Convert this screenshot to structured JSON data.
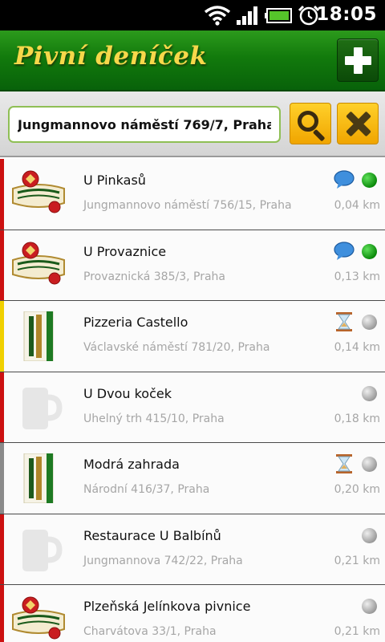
{
  "status_bar": {
    "time": "18:05",
    "icons": [
      "wifi-icon",
      "signal-icon",
      "battery-icon",
      "alarm-icon"
    ]
  },
  "app": {
    "title": "Pivní deníček",
    "add_button_icon": "plus-icon"
  },
  "search": {
    "value": "Jungmannovo náměstí 769/7, Praha",
    "search_icon": "search-icon",
    "clear_icon": "clear-icon"
  },
  "colors": {
    "header_green": "#127a0c",
    "title_yellow": "#f6d84a",
    "button_orange": "#f0a500",
    "stripe_red": "#cc1111",
    "stripe_yellow": "#f0d000",
    "stripe_grey": "#8a8a8a"
  },
  "pubs": [
    {
      "name": "U Pinkasů",
      "address": "Jungmannovo náměstí 756/15, Praha",
      "distance": "0,04 km",
      "logo": "pilsner-urquell-logo",
      "stripe": "red",
      "extra_icon": "comment-icon",
      "status": "green"
    },
    {
      "name": "U Provaznice",
      "address": "Provaznická 385/3, Praha",
      "distance": "0,13 km",
      "logo": "pilsner-urquell-logo",
      "stripe": "red",
      "extra_icon": "comment-icon",
      "status": "green"
    },
    {
      "name": "Pizzeria Castello",
      "address": "Václavské náměstí 781/20, Praha",
      "distance": "0,14 km",
      "logo": "staropramen-logo",
      "stripe": "yellow",
      "extra_icon": "hourglass-icon",
      "status": "grey"
    },
    {
      "name": "U Dvou koček",
      "address": "Uhelný trh 415/10, Praha",
      "distance": "0,18 km",
      "logo": "beer-mug-placeholder",
      "stripe": "red",
      "extra_icon": "",
      "status": "grey"
    },
    {
      "name": "Modrá zahrada",
      "address": "Národní 416/37, Praha",
      "distance": "0,20 km",
      "logo": "staropramen-logo",
      "stripe": "grey",
      "extra_icon": "hourglass-icon",
      "status": "grey"
    },
    {
      "name": "Restaurace U Balbínů",
      "address": "Jungmannova 742/22, Praha",
      "distance": "0,21 km",
      "logo": "beer-mug-placeholder",
      "stripe": "red",
      "extra_icon": "",
      "status": "grey"
    },
    {
      "name": "Plzeňská Jelínkova pivnice",
      "address": "Charvátova 33/1, Praha",
      "distance": "0,21 km",
      "logo": "pilsner-urquell-logo",
      "stripe": "red",
      "extra_icon": "",
      "status": "grey"
    }
  ]
}
